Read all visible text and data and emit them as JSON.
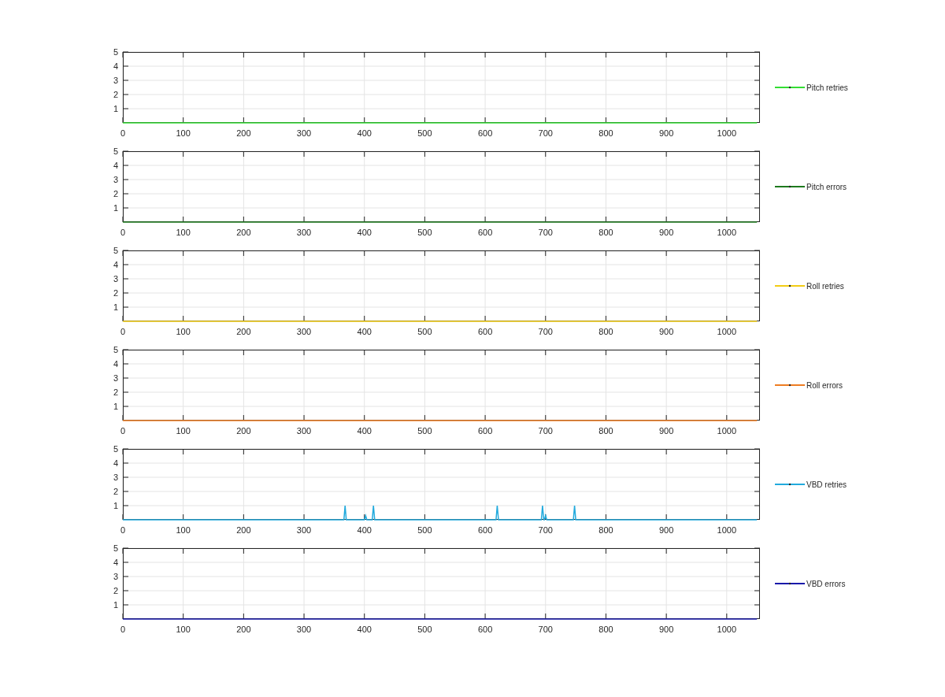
{
  "figure": {
    "subplots": [
      {
        "chart_data": {
          "type": "line",
          "x": [
            0,
            1050
          ],
          "series": [
            {
              "name": "Pitch retries",
              "color": "#33dd33",
              "values": [
                0,
                0
              ]
            }
          ],
          "grid": true,
          "xlim": [
            0,
            1055
          ],
          "ylim": [
            0,
            5
          ],
          "xticks": [
            0,
            100,
            200,
            300,
            400,
            500,
            600,
            700,
            800,
            900,
            1000
          ],
          "yticks": [
            1,
            2,
            3,
            4,
            5
          ]
        }
      },
      {
        "chart_data": {
          "type": "line",
          "x": [
            0,
            1050
          ],
          "series": [
            {
              "name": "Pitch errors",
              "color": "#1e7a1e",
              "values": [
                0,
                0
              ]
            }
          ],
          "grid": true,
          "xlim": [
            0,
            1055
          ],
          "ylim": [
            0,
            5
          ],
          "xticks": [
            0,
            100,
            200,
            300,
            400,
            500,
            600,
            700,
            800,
            900,
            1000
          ],
          "yticks": [
            1,
            2,
            3,
            4,
            5
          ]
        }
      },
      {
        "chart_data": {
          "type": "line",
          "x": [
            0,
            1050
          ],
          "series": [
            {
              "name": "Roll retries",
              "color": "#f2cc14",
              "values": [
                0,
                0
              ]
            }
          ],
          "grid": true,
          "xlim": [
            0,
            1055
          ],
          "ylim": [
            0,
            5
          ],
          "xticks": [
            0,
            100,
            200,
            300,
            400,
            500,
            600,
            700,
            800,
            900,
            1000
          ],
          "yticks": [
            1,
            2,
            3,
            4,
            5
          ]
        }
      },
      {
        "chart_data": {
          "type": "line",
          "x": [
            0,
            1050
          ],
          "series": [
            {
              "name": "Roll errors",
              "color": "#ee7d22",
              "values": [
                0,
                0
              ]
            }
          ],
          "grid": true,
          "xlim": [
            0,
            1055
          ],
          "ylim": [
            0,
            5
          ],
          "xticks": [
            0,
            100,
            200,
            300,
            400,
            500,
            600,
            700,
            800,
            900,
            1000
          ],
          "yticks": [
            1,
            2,
            3,
            4,
            5
          ]
        }
      },
      {
        "chart_data": {
          "type": "line",
          "x": [
            0,
            366,
            368,
            370,
            400,
            402,
            404,
            413,
            415,
            417,
            618,
            620,
            622,
            693,
            695,
            697,
            698,
            700,
            702,
            746,
            748,
            750,
            1050
          ],
          "series": [
            {
              "name": "VBD retries",
              "color": "#22aadd",
              "values": [
                0,
                0,
                1,
                0,
                0,
                0.3,
                0,
                0,
                1,
                0,
                0,
                1,
                0,
                0,
                1,
                0,
                0,
                0.3,
                0,
                0,
                1,
                0,
                0
              ]
            }
          ],
          "grid": true,
          "xlim": [
            0,
            1055
          ],
          "ylim": [
            0,
            5
          ],
          "xticks": [
            0,
            100,
            200,
            300,
            400,
            500,
            600,
            700,
            800,
            900,
            1000
          ],
          "yticks": [
            1,
            2,
            3,
            4,
            5
          ]
        }
      },
      {
        "chart_data": {
          "type": "line",
          "x": [
            0,
            1050
          ],
          "series": [
            {
              "name": "VBD errors",
              "color": "#1a1aaa",
              "values": [
                0,
                0
              ]
            }
          ],
          "grid": true,
          "xlim": [
            0,
            1055
          ],
          "ylim": [
            0,
            5
          ],
          "xticks": [
            0,
            100,
            200,
            300,
            400,
            500,
            600,
            700,
            800,
            900,
            1000
          ],
          "yticks": [
            1,
            2,
            3,
            4,
            5
          ]
        }
      }
    ]
  }
}
